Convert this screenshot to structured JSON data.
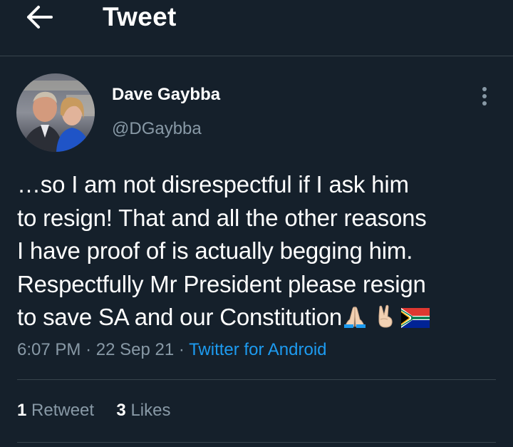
{
  "header": {
    "back_icon": "arrow-left-icon",
    "title": "Tweet"
  },
  "tweet": {
    "author": {
      "display_name": "Dave Gaybba",
      "handle": "@DGaybba"
    },
    "more_icon": "vertical-ellipsis-icon",
    "lines": [
      "…so I am not disrespectful if I ask him",
      "to resign! That and all the other reasons",
      "I have proof of is actually begging him.",
      "Respectfully Mr President please resign",
      "to save SA and our Constitution"
    ],
    "emojis": [
      "folded-hands-icon",
      "victory-hand-icon",
      "south-africa-flag-icon"
    ],
    "time": "6:07 PM",
    "separator": "·",
    "date": "22 Sep 21",
    "source": "Twitter for Android"
  },
  "stats": {
    "retweets_count": "1",
    "retweets_label": "Retweet",
    "likes_count": "3",
    "likes_label": "Likes"
  },
  "colors": {
    "background": "#15202b",
    "text_primary": "#ffffff",
    "text_secondary": "#8899a6",
    "accent": "#1d9bf0",
    "border": "#38444d"
  }
}
